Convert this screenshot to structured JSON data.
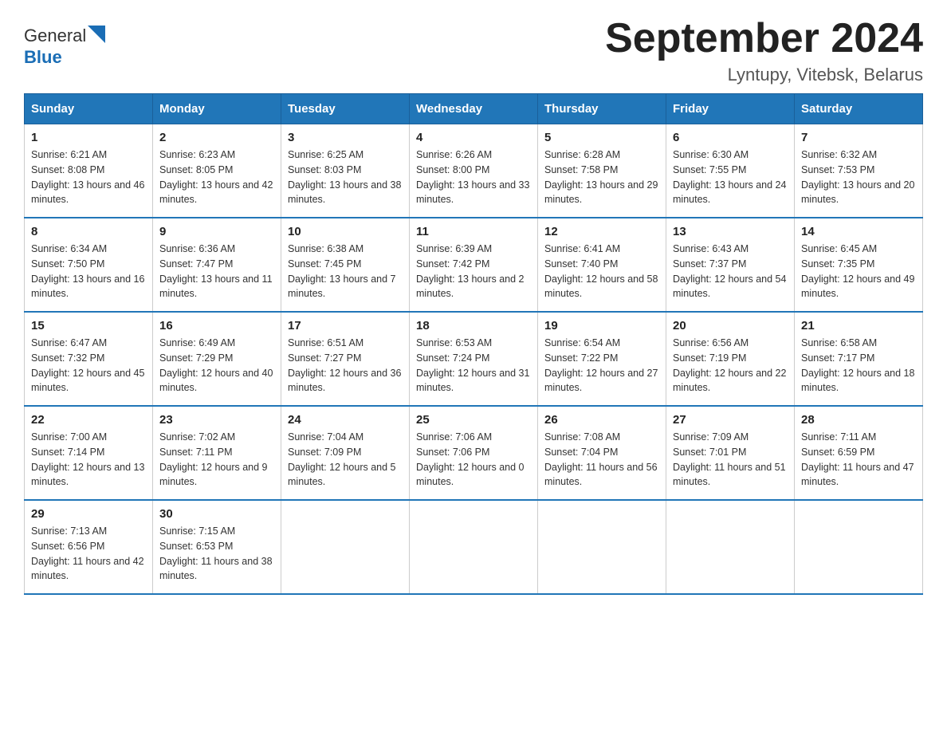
{
  "logo": {
    "text_general": "General",
    "text_blue": "Blue"
  },
  "title": "September 2024",
  "subtitle": "Lyntupy, Vitebsk, Belarus",
  "weekdays": [
    "Sunday",
    "Monday",
    "Tuesday",
    "Wednesday",
    "Thursday",
    "Friday",
    "Saturday"
  ],
  "weeks": [
    [
      {
        "day": "1",
        "sunrise": "6:21 AM",
        "sunset": "8:08 PM",
        "daylight": "13 hours and 46 minutes."
      },
      {
        "day": "2",
        "sunrise": "6:23 AM",
        "sunset": "8:05 PM",
        "daylight": "13 hours and 42 minutes."
      },
      {
        "day": "3",
        "sunrise": "6:25 AM",
        "sunset": "8:03 PM",
        "daylight": "13 hours and 38 minutes."
      },
      {
        "day": "4",
        "sunrise": "6:26 AM",
        "sunset": "8:00 PM",
        "daylight": "13 hours and 33 minutes."
      },
      {
        "day": "5",
        "sunrise": "6:28 AM",
        "sunset": "7:58 PM",
        "daylight": "13 hours and 29 minutes."
      },
      {
        "day": "6",
        "sunrise": "6:30 AM",
        "sunset": "7:55 PM",
        "daylight": "13 hours and 24 minutes."
      },
      {
        "day": "7",
        "sunrise": "6:32 AM",
        "sunset": "7:53 PM",
        "daylight": "13 hours and 20 minutes."
      }
    ],
    [
      {
        "day": "8",
        "sunrise": "6:34 AM",
        "sunset": "7:50 PM",
        "daylight": "13 hours and 16 minutes."
      },
      {
        "day": "9",
        "sunrise": "6:36 AM",
        "sunset": "7:47 PM",
        "daylight": "13 hours and 11 minutes."
      },
      {
        "day": "10",
        "sunrise": "6:38 AM",
        "sunset": "7:45 PM",
        "daylight": "13 hours and 7 minutes."
      },
      {
        "day": "11",
        "sunrise": "6:39 AM",
        "sunset": "7:42 PM",
        "daylight": "13 hours and 2 minutes."
      },
      {
        "day": "12",
        "sunrise": "6:41 AM",
        "sunset": "7:40 PM",
        "daylight": "12 hours and 58 minutes."
      },
      {
        "day": "13",
        "sunrise": "6:43 AM",
        "sunset": "7:37 PM",
        "daylight": "12 hours and 54 minutes."
      },
      {
        "day": "14",
        "sunrise": "6:45 AM",
        "sunset": "7:35 PM",
        "daylight": "12 hours and 49 minutes."
      }
    ],
    [
      {
        "day": "15",
        "sunrise": "6:47 AM",
        "sunset": "7:32 PM",
        "daylight": "12 hours and 45 minutes."
      },
      {
        "day": "16",
        "sunrise": "6:49 AM",
        "sunset": "7:29 PM",
        "daylight": "12 hours and 40 minutes."
      },
      {
        "day": "17",
        "sunrise": "6:51 AM",
        "sunset": "7:27 PM",
        "daylight": "12 hours and 36 minutes."
      },
      {
        "day": "18",
        "sunrise": "6:53 AM",
        "sunset": "7:24 PM",
        "daylight": "12 hours and 31 minutes."
      },
      {
        "day": "19",
        "sunrise": "6:54 AM",
        "sunset": "7:22 PM",
        "daylight": "12 hours and 27 minutes."
      },
      {
        "day": "20",
        "sunrise": "6:56 AM",
        "sunset": "7:19 PM",
        "daylight": "12 hours and 22 minutes."
      },
      {
        "day": "21",
        "sunrise": "6:58 AM",
        "sunset": "7:17 PM",
        "daylight": "12 hours and 18 minutes."
      }
    ],
    [
      {
        "day": "22",
        "sunrise": "7:00 AM",
        "sunset": "7:14 PM",
        "daylight": "12 hours and 13 minutes."
      },
      {
        "day": "23",
        "sunrise": "7:02 AM",
        "sunset": "7:11 PM",
        "daylight": "12 hours and 9 minutes."
      },
      {
        "day": "24",
        "sunrise": "7:04 AM",
        "sunset": "7:09 PM",
        "daylight": "12 hours and 5 minutes."
      },
      {
        "day": "25",
        "sunrise": "7:06 AM",
        "sunset": "7:06 PM",
        "daylight": "12 hours and 0 minutes."
      },
      {
        "day": "26",
        "sunrise": "7:08 AM",
        "sunset": "7:04 PM",
        "daylight": "11 hours and 56 minutes."
      },
      {
        "day": "27",
        "sunrise": "7:09 AM",
        "sunset": "7:01 PM",
        "daylight": "11 hours and 51 minutes."
      },
      {
        "day": "28",
        "sunrise": "7:11 AM",
        "sunset": "6:59 PM",
        "daylight": "11 hours and 47 minutes."
      }
    ],
    [
      {
        "day": "29",
        "sunrise": "7:13 AM",
        "sunset": "6:56 PM",
        "daylight": "11 hours and 42 minutes."
      },
      {
        "day": "30",
        "sunrise": "7:15 AM",
        "sunset": "6:53 PM",
        "daylight": "11 hours and 38 minutes."
      },
      null,
      null,
      null,
      null,
      null
    ]
  ]
}
